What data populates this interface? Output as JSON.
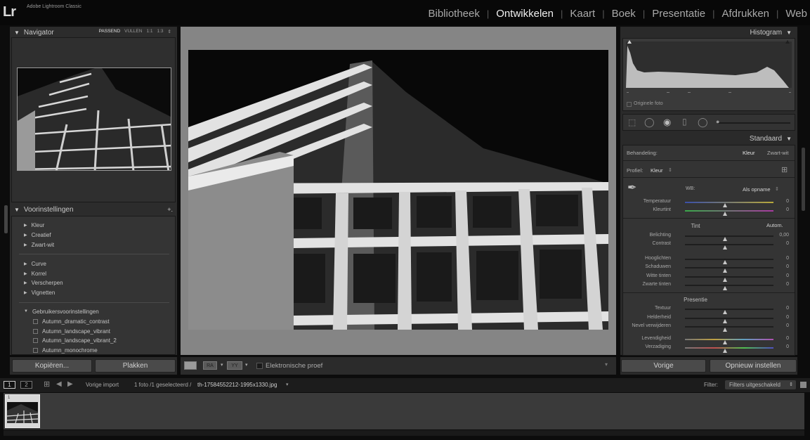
{
  "app": {
    "logo": "Lr",
    "name": "Adobe Lightroom Classic"
  },
  "modules": [
    {
      "label": "Bibliotheek",
      "active": false
    },
    {
      "label": "Ontwikkelen",
      "active": true
    },
    {
      "label": "Kaart",
      "active": false
    },
    {
      "label": "Boek",
      "active": false
    },
    {
      "label": "Presentatie",
      "active": false
    },
    {
      "label": "Afdrukken",
      "active": false
    },
    {
      "label": "Web",
      "active": false
    }
  ],
  "navigator": {
    "title": "Navigator",
    "options": [
      "PASSEND",
      "VULLEN",
      "1:1",
      "1:3"
    ],
    "active_option": "PASSEND"
  },
  "presets": {
    "title": "Voorinstellingen",
    "add": "+.",
    "group1": [
      "Kleur",
      "Creatief",
      "Zwart-wit"
    ],
    "group2": [
      "Curve",
      "Korrel",
      "Verscherpen",
      "Vignetten"
    ],
    "user_group": "Gebruikersvoorinstellingen",
    "user_items": [
      "Autumn_dramatic_contrast",
      "Autumn_landscape_vibrant",
      "Autumn_landscape_vibrant_2",
      "Autumn_monochrome"
    ]
  },
  "left_buttons": {
    "copy": "Kopiëren...",
    "paste": "Plakken"
  },
  "toolbar": {
    "softproof": "Elektronische proef",
    "icon_ra": "RA",
    "icon_yy": "YY"
  },
  "histogram": {
    "title": "Histogram",
    "original": "Originele foto"
  },
  "basic": {
    "title": "Standaard",
    "treatment_label": "Behandeling:",
    "treatment_options": [
      "Kleur",
      "Zwart-wit"
    ],
    "treatment_active": "Kleur",
    "profile_label": "Profiel:",
    "profile_value": "Kleur",
    "wb_label": "WB:",
    "wb_value": "Als opname",
    "tone_title": "Tint",
    "auto": "Autom.",
    "presence_title": "Presentie"
  },
  "sliders": {
    "temp": {
      "label": "Temperatuur",
      "value": "0",
      "pos": 0.45
    },
    "tint": {
      "label": "Kleurtint",
      "value": "0",
      "pos": 0.45
    },
    "exposure": {
      "label": "Belichting",
      "value": "0,00",
      "pos": 0.45
    },
    "contrast": {
      "label": "Contrast",
      "value": "0",
      "pos": 0.45
    },
    "highlights": {
      "label": "Hooglichten",
      "value": "0",
      "pos": 0.45
    },
    "shadows": {
      "label": "Schaduwen",
      "value": "0",
      "pos": 0.45
    },
    "whites": {
      "label": "Witte tinten",
      "value": "0",
      "pos": 0.45
    },
    "blacks": {
      "label": "Zwarte tinten",
      "value": "0",
      "pos": 0.45
    },
    "texture": {
      "label": "Textuur",
      "value": "0",
      "pos": 0.45
    },
    "clarity": {
      "label": "Helderheid",
      "value": "0",
      "pos": 0.45
    },
    "dehaze": {
      "label": "Nevel verwijderen",
      "value": "0",
      "pos": 0.45
    },
    "vibrance": {
      "label": "Levendigheid",
      "value": "0",
      "pos": 0.45
    },
    "saturation": {
      "label": "Verzadiging",
      "value": "0",
      "pos": 0.45
    }
  },
  "right_buttons": {
    "previous": "Vorige",
    "reset": "Opnieuw instellen"
  },
  "filmbar": {
    "page1": "1",
    "page2": "2",
    "source": "Vorige import",
    "info": "1 foto /1 geselecteerd /",
    "filename": "th-17584552212-1995x1330.jpg",
    "filter_label": "Filter:",
    "filter_value": "Filters uitgeschakeld"
  },
  "filmstrip": {
    "thumb_index": "1"
  },
  "colors": {
    "accent_active": "#f0f0f0",
    "panel_bg": "#2c2c2c",
    "canvas_bg": "#858585"
  }
}
